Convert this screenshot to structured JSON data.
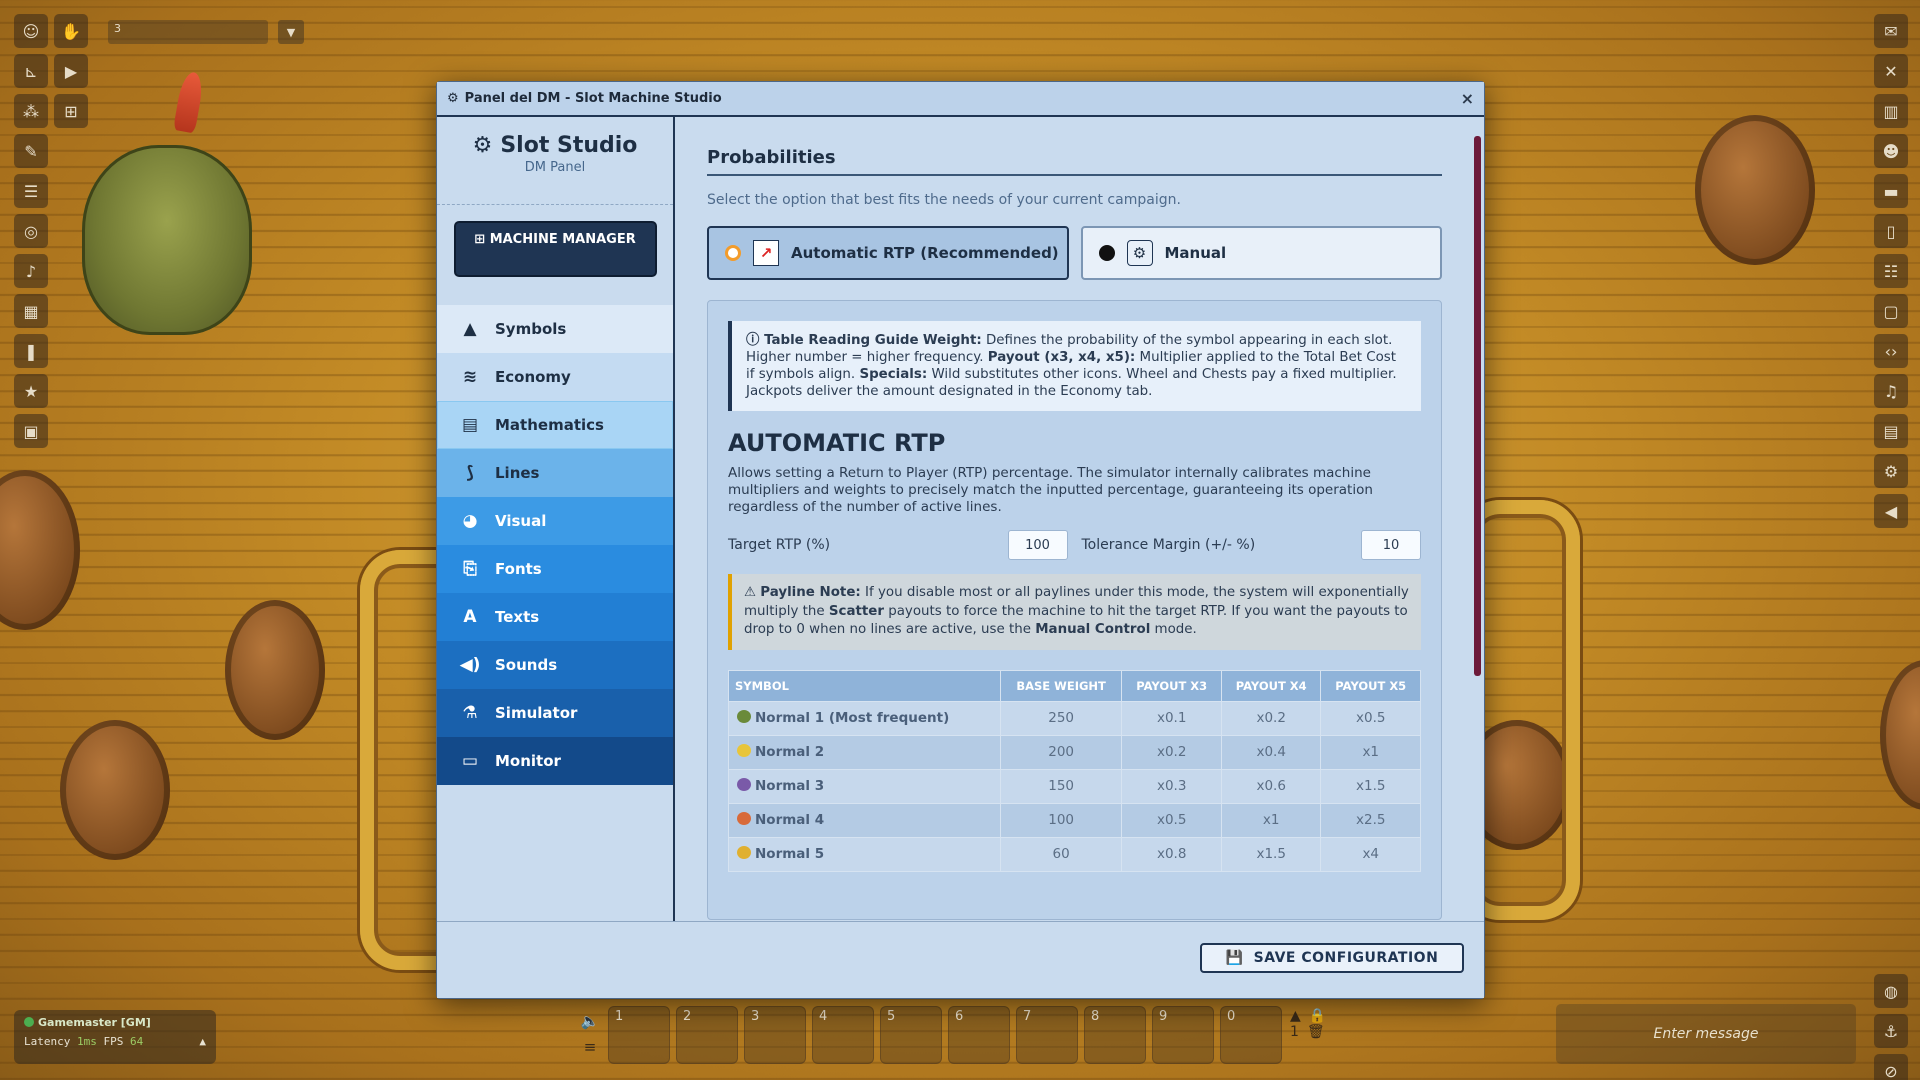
{
  "vtt": {
    "coord_value": "3",
    "gm_name": "Gamemaster [GM]",
    "latency_label": "Latency",
    "latency_value": "1ms",
    "fps_label": "FPS",
    "fps_value": "64",
    "hotbar": [
      "1",
      "2",
      "3",
      "4",
      "5",
      "6",
      "7",
      "8",
      "9",
      "0"
    ],
    "hotbar_page": "1",
    "chat_placeholder": "Enter message"
  },
  "modal": {
    "title": "Panel del DM - Slot Machine Studio",
    "close": "×",
    "brand_title": "Slot Studio",
    "brand_sub": "DM Panel",
    "machine_manager": "MACHINE MANAGER",
    "nav": [
      {
        "label": "Symbols",
        "icon": "shapes-icon",
        "glyph": "▲",
        "bg": "#dce9f7",
        "fg": "#1e2f44"
      },
      {
        "label": "Economy",
        "icon": "coins-icon",
        "glyph": "≋",
        "bg": "#c4dbf2",
        "fg": "#1e2f44"
      },
      {
        "label": "Mathematics",
        "icon": "calculator-icon",
        "glyph": "▤",
        "bg": "#a9d5f5",
        "fg": "#1e2f44"
      },
      {
        "label": "Lines",
        "icon": "lines-icon",
        "glyph": "⟆",
        "bg": "#6bb3ea",
        "fg": "#1e2f44"
      },
      {
        "label": "Visual",
        "icon": "palette-icon",
        "glyph": "◕",
        "bg": "#3d9be6",
        "fg": "#ffffff"
      },
      {
        "label": "Fonts",
        "icon": "file-font-icon",
        "glyph": "⎘",
        "bg": "#2a8ce0",
        "fg": "#ffffff"
      },
      {
        "label": "Texts",
        "icon": "letter-a-icon",
        "glyph": "A",
        "bg": "#227fd4",
        "fg": "#ffffff"
      },
      {
        "label": "Sounds",
        "icon": "speaker-icon",
        "glyph": "◀)",
        "bg": "#1c6fc1",
        "fg": "#ffffff"
      },
      {
        "label": "Simulator",
        "icon": "flask-icon",
        "glyph": "⚗",
        "bg": "#1960ab",
        "fg": "#ffffff"
      },
      {
        "label": "Monitor",
        "icon": "monitor-icon",
        "glyph": "▭",
        "bg": "#134a8a",
        "fg": "#ffffff"
      }
    ],
    "prob_title": "Probabilities",
    "prob_sub": "Select the option that best fits the needs of your current campaign.",
    "opt_auto": "Automatic RTP (Recommended)",
    "opt_manual": "Manual",
    "guide_title": "Table Reading Guide",
    "guide_weight_b": "Weight:",
    "guide_weight_t": " Defines the probability of the symbol appearing in each slot. Higher number = higher frequency. ",
    "guide_payout_b": "Payout (x3, x4, x5):",
    "guide_payout_t": " Multiplier applied to the Total Bet Cost if symbols align. ",
    "guide_special_b": "Specials:",
    "guide_special_t": " Wild substitutes other icons. Wheel and Chests pay a fixed multiplier. Jackpots deliver the amount designated in the Economy tab.",
    "auto_title": "AUTOMATIC RTP",
    "auto_desc": "Allows setting a Return to Player (RTP) percentage. The simulator internally calibrates machine multipliers and weights to precisely match the inputted percentage, guaranteeing its operation regardless of the number of active lines.",
    "target_label": "Target RTP (%)",
    "target_value": "100",
    "tol_label": "Tolerance Margin (+/- %)",
    "tol_value": "10",
    "warn_b": "Payline Note:",
    "warn_t1": " If you disable most or all paylines under this mode, the system will exponentially multiply the ",
    "warn_b2": "Scatter",
    "warn_t2": " payouts to force the machine to hit the target RTP. If you want the payouts to drop to 0 when no lines are active, use the ",
    "warn_b3": "Manual Control",
    "warn_t3": " mode.",
    "table_headers": [
      "SYMBOL",
      "BASE WEIGHT",
      "PAYOUT X3",
      "PAYOUT X4",
      "PAYOUT X5"
    ],
    "table_rows": [
      {
        "symbol": "Normal 1 (Most frequent)",
        "color": "#6a8a3a",
        "weight": "250",
        "x3": "x0.1",
        "x4": "x0.2",
        "x5": "x0.5"
      },
      {
        "symbol": "Normal 2",
        "color": "#e8c53a",
        "weight": "200",
        "x3": "x0.2",
        "x4": "x0.4",
        "x5": "x1"
      },
      {
        "symbol": "Normal 3",
        "color": "#7a5aa8",
        "weight": "150",
        "x3": "x0.3",
        "x4": "x0.6",
        "x5": "x1.5"
      },
      {
        "symbol": "Normal 4",
        "color": "#d86a3a",
        "weight": "100",
        "x3": "x0.5",
        "x4": "x1",
        "x5": "x2.5"
      },
      {
        "symbol": "Normal 5",
        "color": "#e0b030",
        "weight": "60",
        "x3": "x0.8",
        "x4": "x1.5",
        "x5": "x4"
      }
    ],
    "save_label": "SAVE CONFIGURATION"
  }
}
